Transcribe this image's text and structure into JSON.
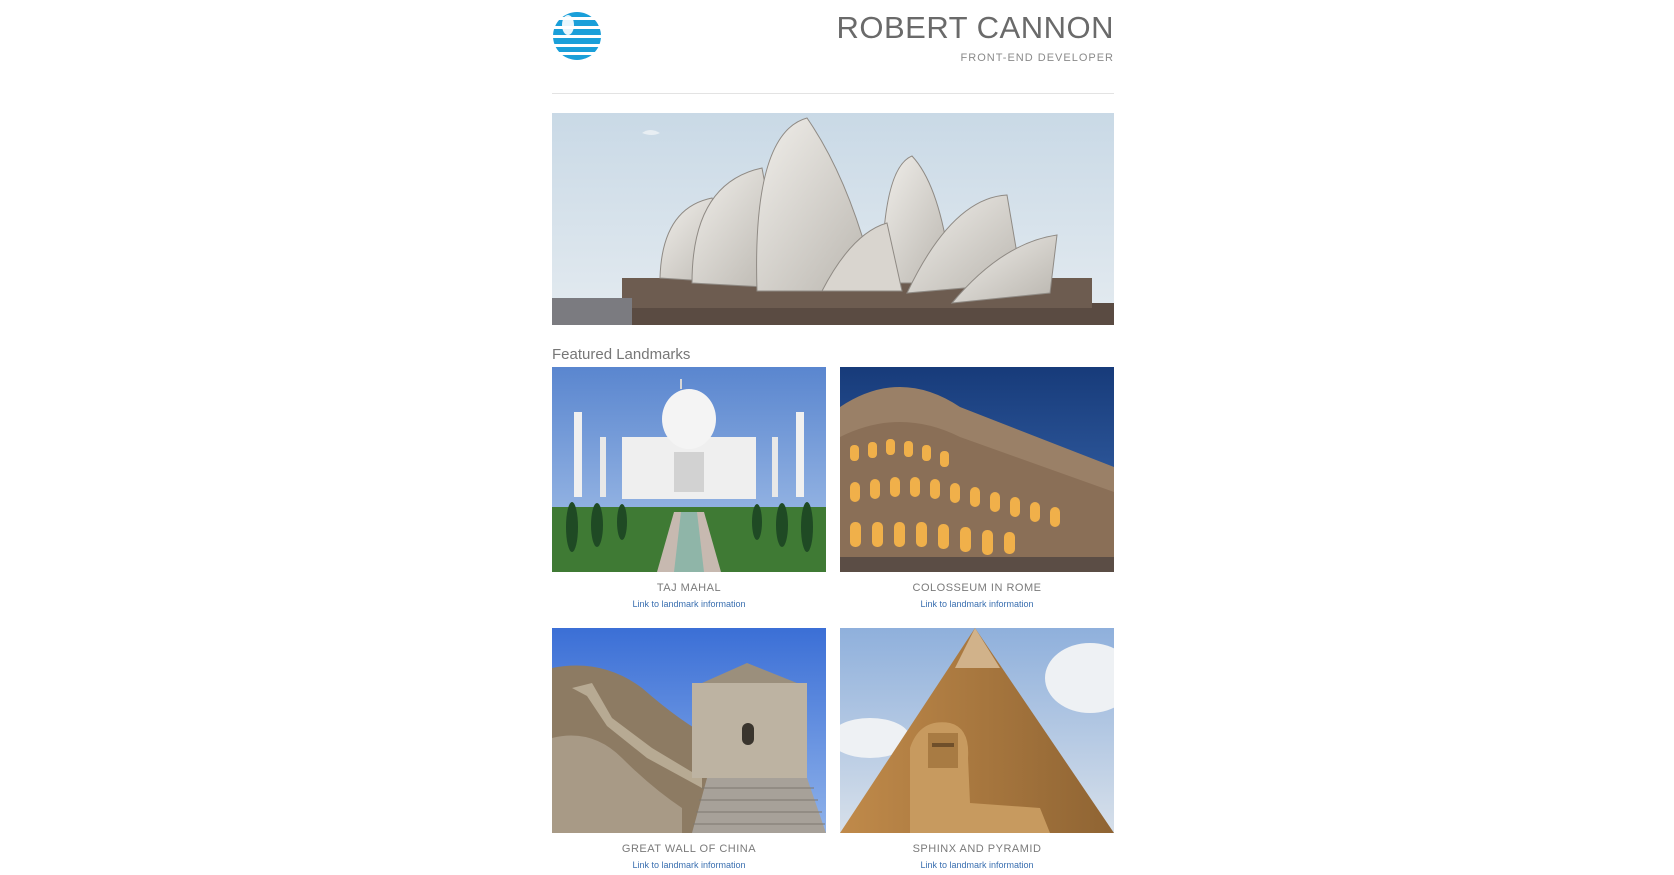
{
  "header": {
    "logo_icon": "att-globe-icon",
    "name": "ROBERT CANNON",
    "role": "FRONT-END DEVELOPER"
  },
  "hero": {
    "image_icon": "sydney-opera-house-image"
  },
  "featured": {
    "title": "Featured Landmarks",
    "items": [
      {
        "caption": "TAJ MAHAL",
        "link": "Link to landmark information",
        "image_icon": "taj-mahal-image"
      },
      {
        "caption": "COLOSSEUM IN ROME",
        "link": "Link to landmark information",
        "image_icon": "colosseum-image"
      },
      {
        "caption": "GREAT WALL OF CHINA",
        "link": "Link to landmark information",
        "image_icon": "great-wall-image"
      },
      {
        "caption": "SPHINX AND PYRAMID",
        "link": "Link to landmark information",
        "image_icon": "sphinx-pyramid-image"
      }
    ]
  },
  "colors": {
    "link": "#3a6fb0",
    "logo": "#1a9fd9"
  }
}
